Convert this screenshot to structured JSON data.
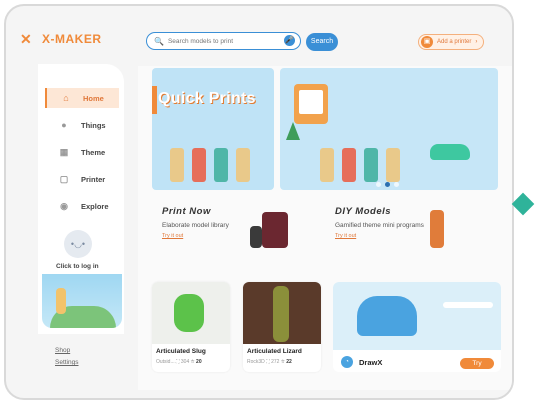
{
  "brand": {
    "logo_text": "X-MAKER",
    "accent": "#f08a3a",
    "blue": "#3a8fd6"
  },
  "search": {
    "placeholder": "Search models to print",
    "button_label": "Search"
  },
  "header": {
    "add_printer_label": "Add a printer"
  },
  "sidebar": {
    "items": [
      {
        "label": "Home",
        "icon": "home-icon",
        "active": true
      },
      {
        "label": "Things",
        "icon": "things-icon",
        "active": false
      },
      {
        "label": "Theme",
        "icon": "grid-icon",
        "active": false
      },
      {
        "label": "Printer",
        "icon": "printer-icon",
        "active": false
      },
      {
        "label": "Explore",
        "icon": "compass-icon",
        "active": false
      }
    ],
    "login_text": "Click to log in",
    "links": {
      "shop": "Shop",
      "settings": "Settings"
    }
  },
  "banner": {
    "title": "Quick Prints",
    "pages": 3,
    "current_page": 1
  },
  "features": {
    "print_now": {
      "title": "Print Now",
      "subtitle": "Elaborate model library",
      "link": "Try it out"
    },
    "diy_models": {
      "title": "DIY Models",
      "subtitle": "Gamified theme mini programs",
      "link": "Try it out"
    }
  },
  "cards": [
    {
      "title": "Articulated Slug",
      "author": "Outsid...",
      "prints": "304",
      "likes": "20"
    },
    {
      "title": "Articulated Lizard",
      "author": "Rock3D",
      "prints": "272",
      "likes": "22"
    }
  ],
  "drawx": {
    "name": "DrawX",
    "button": "Try"
  }
}
